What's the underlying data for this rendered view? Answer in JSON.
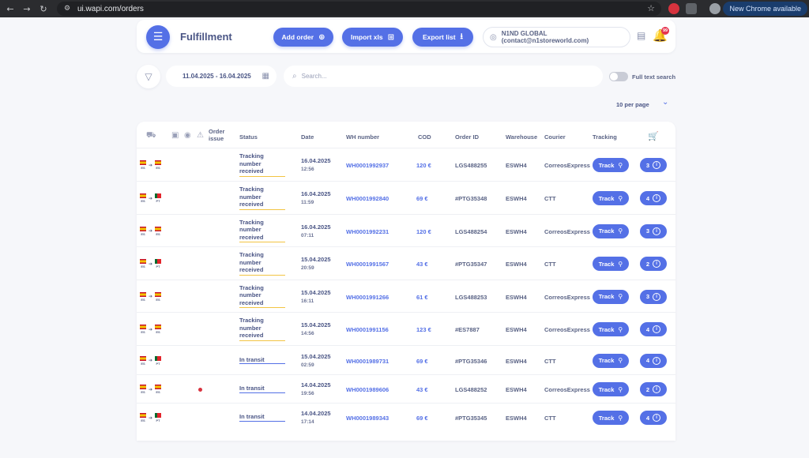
{
  "browser": {
    "url": "ui.wapi.com/orders",
    "new_chrome": "New Chrome available"
  },
  "header": {
    "title": "Fulfillment",
    "add_order": "Add order",
    "import_xls": "Import xls",
    "export_list": "Export list",
    "account": "N1ND GLOBAL (contact@n1storeworld.com)",
    "notification_count": "99"
  },
  "filters": {
    "date_range": "11.04.2025 - 16.04.2025",
    "search_placeholder": "Search...",
    "full_text_search": "Full text search",
    "per_page": "10 per page"
  },
  "table": {
    "headers": {
      "order_issue": "Order issue",
      "status": "Status",
      "date": "Date",
      "wh_number": "WH number",
      "cod": "COD",
      "order_id": "Order ID",
      "warehouse": "Warehouse",
      "courier": "Courier",
      "tracking": "Tracking"
    },
    "track_label": "Track",
    "rows": [
      {
        "from": "ES",
        "to": "ES",
        "issue": false,
        "status": "Tracking number received",
        "status_type": "yellow",
        "date": "16.04.2025",
        "time": "12:56",
        "wh": "WH0001992937",
        "cod": "120 €",
        "order_id": "LGS488255",
        "warehouse": "ESWH4",
        "courier": "CorreosExpress",
        "count": "3"
      },
      {
        "from": "ES",
        "to": "PT",
        "issue": false,
        "status": "Tracking number received",
        "status_type": "yellow",
        "date": "16.04.2025",
        "time": "11:59",
        "wh": "WH0001992840",
        "cod": "69 €",
        "order_id": "#PTG35348",
        "warehouse": "ESWH4",
        "courier": "CTT",
        "count": "4"
      },
      {
        "from": "ES",
        "to": "ES",
        "issue": false,
        "status": "Tracking number received",
        "status_type": "yellow",
        "date": "16.04.2025",
        "time": "07:11",
        "wh": "WH0001992231",
        "cod": "120 €",
        "order_id": "LGS488254",
        "warehouse": "ESWH4",
        "courier": "CorreosExpress",
        "count": "3"
      },
      {
        "from": "ES",
        "to": "PT",
        "issue": false,
        "status": "Tracking number received",
        "status_type": "yellow",
        "date": "15.04.2025",
        "time": "20:59",
        "wh": "WH0001991567",
        "cod": "43 €",
        "order_id": "#PTG35347",
        "warehouse": "ESWH4",
        "courier": "CTT",
        "count": "2"
      },
      {
        "from": "ES",
        "to": "ES",
        "issue": false,
        "status": "Tracking number received",
        "status_type": "yellow",
        "date": "15.04.2025",
        "time": "16:11",
        "wh": "WH0001991266",
        "cod": "61 €",
        "order_id": "LGS488253",
        "warehouse": "ESWH4",
        "courier": "CorreosExpress",
        "count": "3"
      },
      {
        "from": "ES",
        "to": "ES",
        "issue": false,
        "status": "Tracking number received",
        "status_type": "yellow",
        "date": "15.04.2025",
        "time": "14:56",
        "wh": "WH0001991156",
        "cod": "123 €",
        "order_id": "#ES7887",
        "warehouse": "ESWH4",
        "courier": "CorreosExpress",
        "count": "4"
      },
      {
        "from": "ES",
        "to": "PT",
        "issue": false,
        "status": "In transit",
        "status_type": "blue",
        "date": "15.04.2025",
        "time": "02:59",
        "wh": "WH0001989731",
        "cod": "69 €",
        "order_id": "#PTG35346",
        "warehouse": "ESWH4",
        "courier": "CTT",
        "count": "4"
      },
      {
        "from": "ES",
        "to": "ES",
        "issue": true,
        "status": "In transit",
        "status_type": "blue",
        "date": "14.04.2025",
        "time": "19:56",
        "wh": "WH0001989606",
        "cod": "43 €",
        "order_id": "LGS488252",
        "warehouse": "ESWH4",
        "courier": "CorreosExpress",
        "count": "2"
      },
      {
        "from": "ES",
        "to": "PT",
        "issue": false,
        "status": "In transit",
        "status_type": "blue",
        "date": "14.04.2025",
        "time": "17:14",
        "wh": "WH0001989343",
        "cod": "69 €",
        "order_id": "#PTG35345",
        "warehouse": "ESWH4",
        "courier": "CTT",
        "count": "4"
      }
    ]
  }
}
